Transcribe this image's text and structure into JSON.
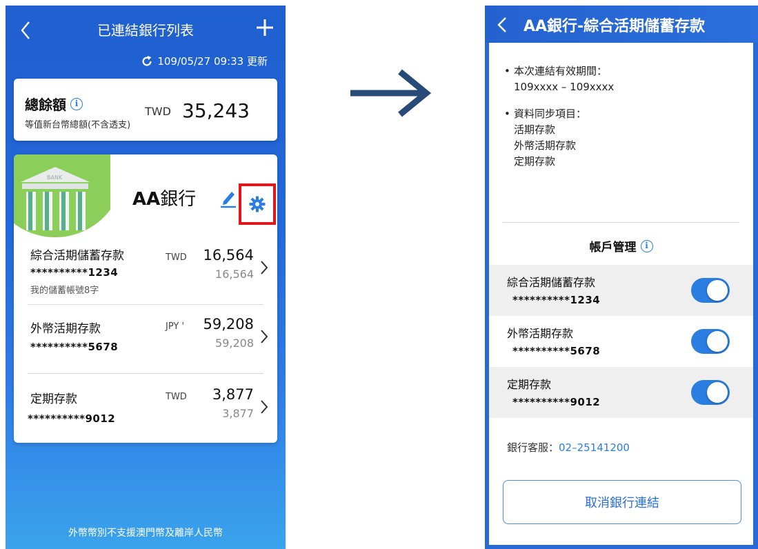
{
  "left": {
    "header": {
      "title": "已連結銀行列表"
    },
    "update": {
      "text": "109/05/27 09:33 更新"
    },
    "total": {
      "title": "總餘額",
      "subtitle": "等值新台幣總額(不含透支)",
      "currency": "TWD",
      "amount": "35,243"
    },
    "bank": {
      "name_latin": "AA",
      "name_cjk": "銀行",
      "art_label": "BANK",
      "accounts": [
        {
          "name": "綜合活期儲蓄存款",
          "number": "**********1234",
          "nickname": "我的儲蓄帳號8字",
          "currency": "TWD",
          "amount": "16,564",
          "sub": "16,564"
        },
        {
          "name": "外幣活期存款",
          "number": "**********5678",
          "nickname": "",
          "currency": "JPY '",
          "amount": "59,208",
          "sub": "59,208"
        },
        {
          "name": "定期存款",
          "number": "**********9012",
          "nickname": "",
          "currency": "TWD",
          "amount": "3,877",
          "sub": "3,877"
        }
      ]
    },
    "footer": "外幣幣別不支援澳門幣及離岸人民幣"
  },
  "right": {
    "header": {
      "title": "AA銀行-綜合活期儲蓄存款"
    },
    "validity": {
      "label": "本次連結有效期間：",
      "value": "109xxxx – 109xxxx"
    },
    "sync": {
      "label": "資料同步項目：",
      "items": [
        "活期存款",
        "外幣活期存款",
        "定期存款"
      ]
    },
    "management": {
      "title": "帳戶管理",
      "accounts": [
        {
          "name": "綜合活期儲蓄存款",
          "number": "**********1234",
          "enabled": true
        },
        {
          "name": "外幣活期存款",
          "number": "**********5678",
          "enabled": true
        },
        {
          "name": "定期存款",
          "number": "**********9012",
          "enabled": true
        }
      ]
    },
    "service": {
      "label": "銀行客服：",
      "phone": "02–25141200"
    },
    "cancel_button": "取消銀行連結"
  },
  "colors": {
    "primary": "#2a7de1",
    "highlight": "#e0181e",
    "arrow": "#274a78",
    "art_green": "#8bcf5a"
  }
}
